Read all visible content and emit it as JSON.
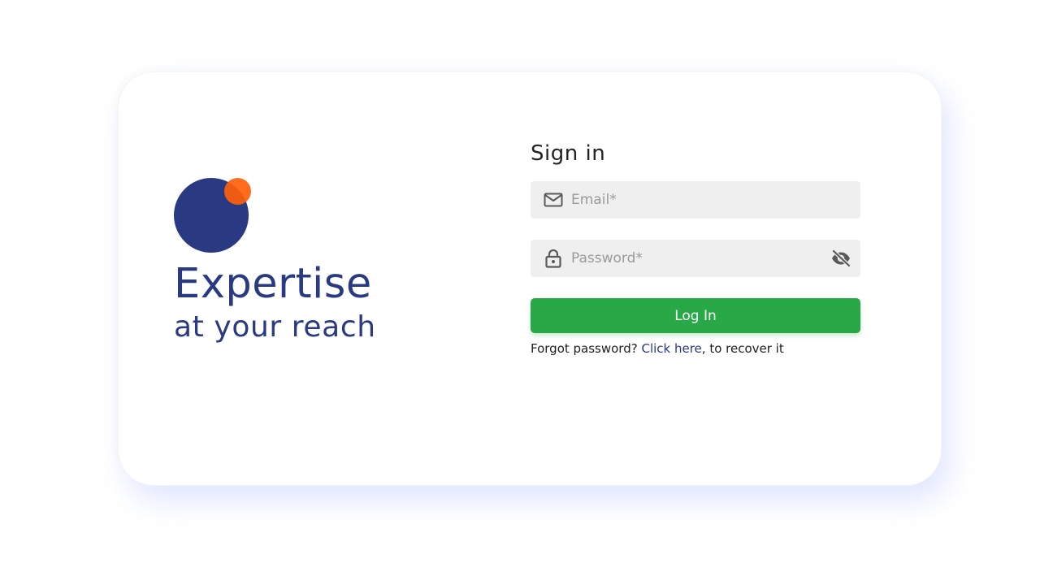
{
  "brand": {
    "title": "Expertise",
    "subtitle": "at your reach",
    "colors": {
      "primary": "#2a3a82",
      "accent": "#ff5f0a"
    }
  },
  "form": {
    "title": "Sign in",
    "email": {
      "placeholder": "Email*",
      "value": "",
      "icon": "mail-icon"
    },
    "password": {
      "placeholder": "Password*",
      "value": "",
      "icon": "lock-icon",
      "toggle_icon": "eye-off-icon"
    },
    "login_label": "Log In",
    "login_color": "#29a847",
    "forgot": {
      "prefix": "Forgot password? ",
      "link": "Click here",
      "suffix": ", to recover it"
    }
  }
}
